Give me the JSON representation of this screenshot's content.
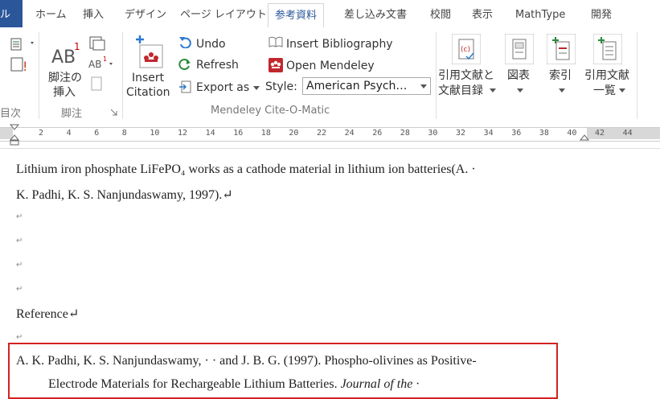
{
  "tabs": {
    "file_fragment": "ル",
    "home": "ホーム",
    "insert": "挿入",
    "design": "デザイン",
    "page_layout": "ページ レイアウト",
    "references": "参考資料",
    "mailings": "差し込み文書",
    "review": "校閲",
    "view": "表示",
    "mathtype": "MathType",
    "developer": "開発"
  },
  "ribbon": {
    "toc_group_fragment": "目次",
    "footnote_insert_label": "脚注の\n挿入",
    "footnote_insert_line1": "脚注の",
    "footnote_insert_line2": "挿入",
    "footnotes_group": "脚注",
    "insert_citation_line1": "Insert",
    "insert_citation_line2": "Citation",
    "undo": "Undo",
    "refresh": "Refresh",
    "export_as": "Export as",
    "insert_bibliography": "Insert Bibliography",
    "open_mendeley": "Open Mendeley",
    "style_label": "Style:",
    "style_value": "American Psych…",
    "mendeley_group": "Mendeley Cite-O-Matic",
    "citations_line1": "引用文献と",
    "citations_line2": "文献目録",
    "captions": "図表",
    "index": "索引",
    "toa_line1": "引用文献",
    "toa_line2": "一覧"
  },
  "ruler": {
    "ticks": [
      "2",
      "4",
      "6",
      "8",
      "10",
      "12",
      "14",
      "16",
      "18",
      "20",
      "22",
      "24",
      "26",
      "28",
      "30",
      "32",
      "34",
      "36",
      "38",
      "40",
      "42",
      "44"
    ]
  },
  "document": {
    "para1_line1": "Lithium iron phosphate LiFePO₄ works as a cathode material in lithium ion batteries(A. ·",
    "para1_line2": "K. Padhi, K. S. Nanjundaswamy, 1997).↵",
    "empty_mark": "↵",
    "reference_heading": "Reference↵",
    "ref_line1": "A. K. Padhi, K. S. Nanjundaswamy, · · and J. B. G. (1997). Phospho-olivines as Positive-",
    "ref_line2_plain": "Electrode Materials for Rechargeable Lithium Batteries. ",
    "ref_line2_italic": "Journal of the ·"
  },
  "colors": {
    "file_tab": "#2b579a",
    "highlight_box": "#d32222",
    "mendeley_red": "#c0282d"
  }
}
